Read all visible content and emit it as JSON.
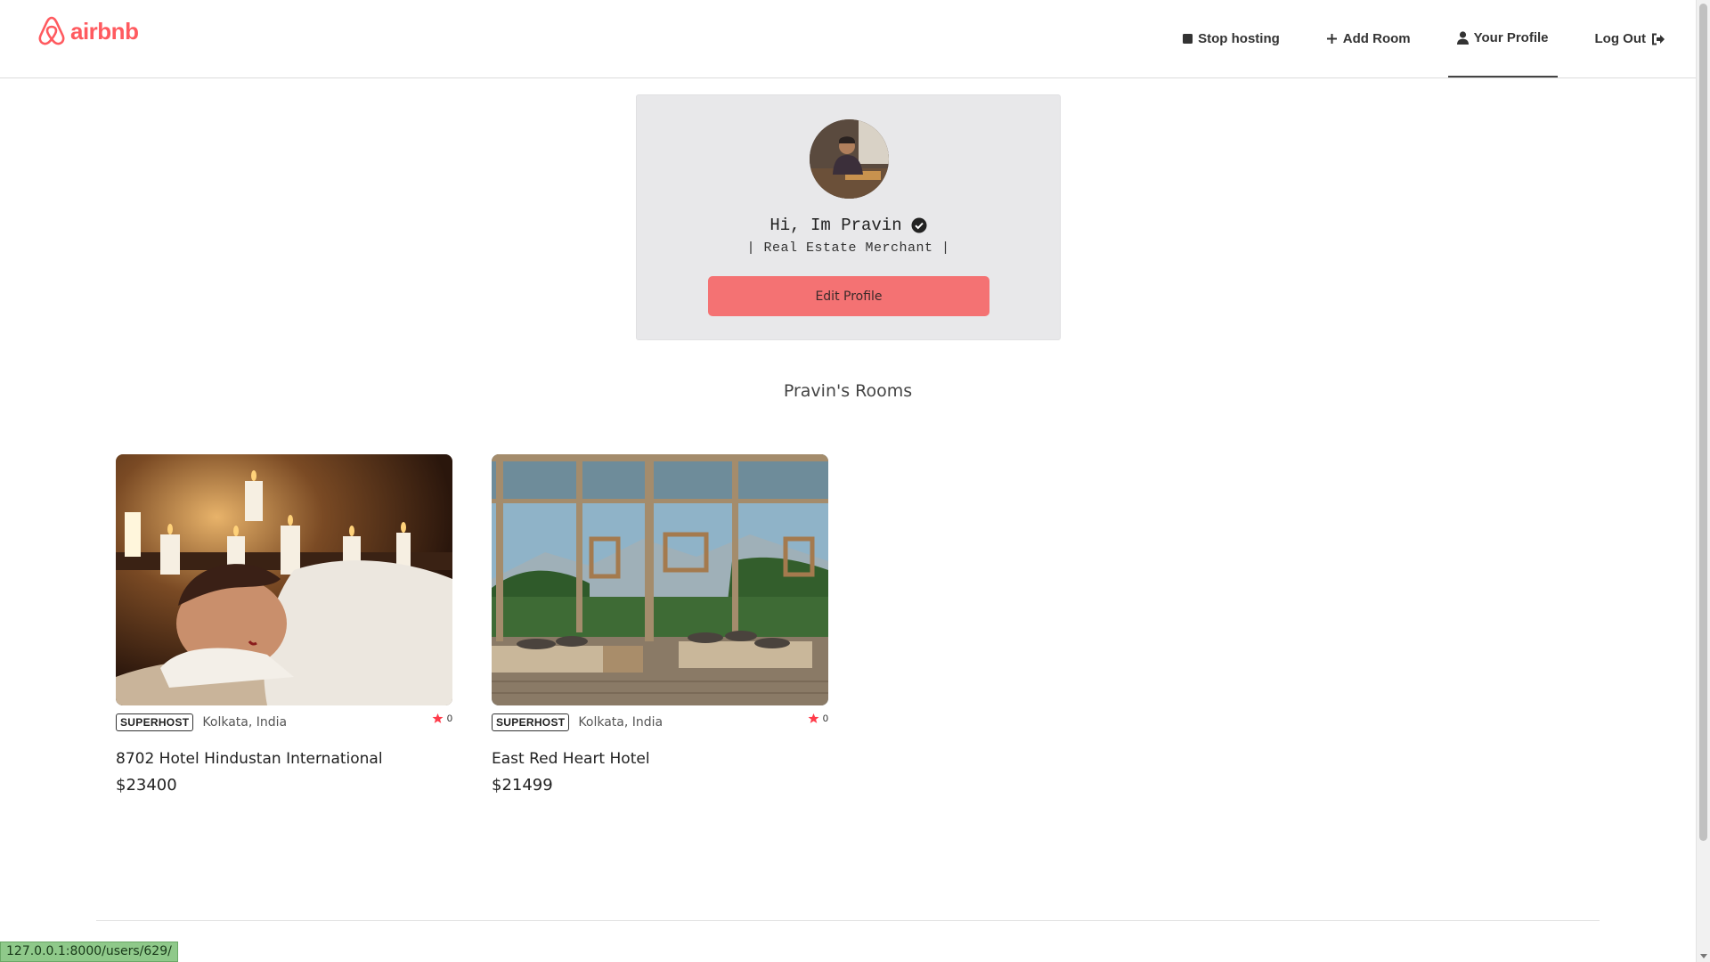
{
  "header": {
    "logo_text": "airbnb",
    "brand_color": "#ff5a5f",
    "nav": {
      "stop_hosting": "Stop hosting",
      "add_room": "Add Room",
      "your_profile": "Your Profile",
      "log_out": "Log Out"
    }
  },
  "profile": {
    "greeting": "Hi, Im Pravin",
    "occupation": "| Real Estate Merchant |",
    "edit_button": "Edit Profile",
    "button_color": "#f47273"
  },
  "rooms_section": {
    "title": "Pravin's Rooms",
    "rooms": [
      {
        "badge": "SUPERHOST",
        "location": "Kolkata, India",
        "rating": "0",
        "name": "8702 Hotel Hindustan International",
        "price": "$23400"
      },
      {
        "badge": "SUPERHOST",
        "location": "Kolkata, India",
        "rating": "0",
        "name": "East Red Heart Hotel",
        "price": "$21499"
      }
    ]
  },
  "status_bar": {
    "url": "127.0.0.1:8000/users/629/"
  }
}
